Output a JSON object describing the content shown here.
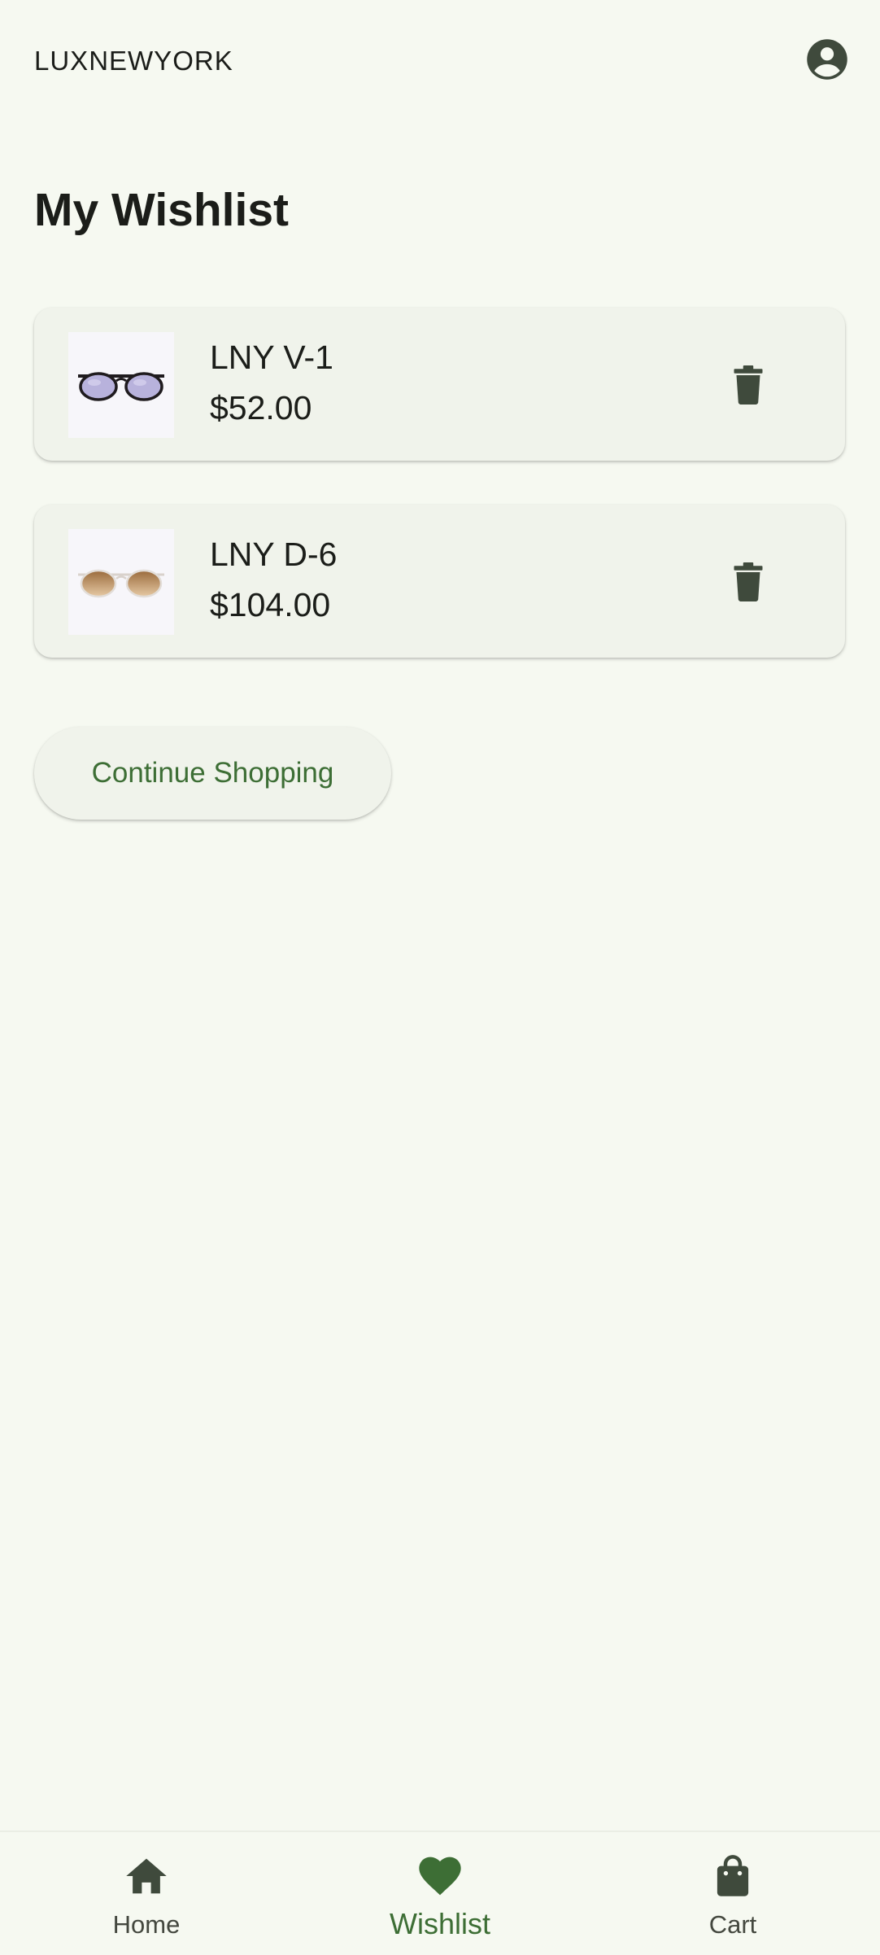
{
  "header": {
    "brand": "LUXNEWYORK",
    "account_icon": "account-circle-icon"
  },
  "page": {
    "title": "My Wishlist"
  },
  "wishlist": {
    "items": [
      {
        "name": "LNY V-1",
        "price": "$52.00",
        "image": "sunglasses-purple-lens",
        "delete_icon": "trash-icon"
      },
      {
        "name": "LNY D-6",
        "price": "$104.00",
        "image": "sunglasses-brown-gradient-lens",
        "delete_icon": "trash-icon"
      }
    ]
  },
  "actions": {
    "continue_label": "Continue Shopping"
  },
  "bottom_nav": {
    "items": [
      {
        "label": "Home",
        "icon": "home-icon",
        "active": false
      },
      {
        "label": "Wishlist",
        "icon": "heart-icon",
        "active": true
      },
      {
        "label": "Cart",
        "icon": "shopping-bag-icon",
        "active": false
      }
    ]
  },
  "colors": {
    "background": "#f6f9f1",
    "card": "#f0f3eb",
    "accent": "#3d6e35",
    "icon": "#3f4a3c"
  }
}
